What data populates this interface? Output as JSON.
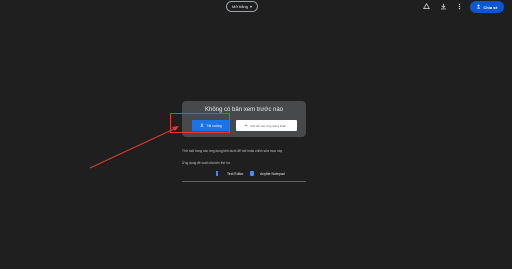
{
  "header": {
    "mode_dropdown_label": "Mở bằng",
    "share_label": "Chia sẻ"
  },
  "preview": {
    "title": "Không có bản xem trước nào",
    "download_label": "Tải xuống",
    "open_with_label": "Kết nối các ứng dụng khác..."
  },
  "apps": {
    "hint": "Thử một trong các ứng dụng bên dưới để mở hoặc chỉnh sửa mục này",
    "suggested_label": "Ứng dụng đề xuất của bên thứ ba",
    "items": [
      {
        "name": "Text Editor",
        "icon": "text-editor-icon"
      },
      {
        "name": "Anyfile Notepad",
        "icon": "anyfile-notepad-icon"
      }
    ]
  },
  "colors": {
    "background": "#1f1f1f",
    "accent": "#0b57d0",
    "highlight": "#e53935"
  }
}
